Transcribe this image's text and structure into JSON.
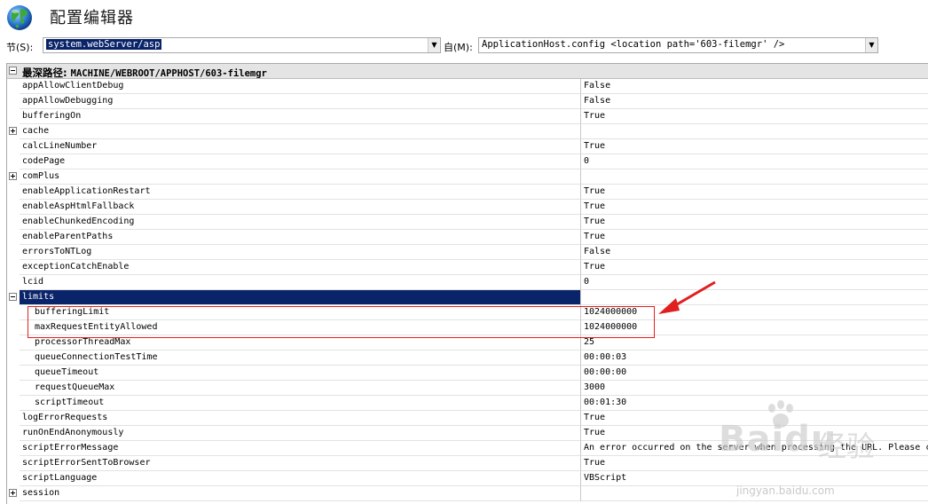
{
  "window": {
    "title": "配置编辑器"
  },
  "toolbar": {
    "section_label": "节(S):",
    "section_value": "system.webServer/asp",
    "from_label": "自(M):",
    "from_value": "ApplicationHost.config <location path='603-filemgr' />"
  },
  "grid": {
    "header_label": "最深路径:",
    "header_path": "MACHINE/WEBROOT/APPHOST/603-filemgr",
    "rows": [
      {
        "name": "appAllowClientDebug",
        "value": "False",
        "expander": "",
        "indent": 0
      },
      {
        "name": "appAllowDebugging",
        "value": "False",
        "expander": "",
        "indent": 0
      },
      {
        "name": "bufferingOn",
        "value": "True",
        "expander": "",
        "indent": 0
      },
      {
        "name": "cache",
        "value": "",
        "expander": "plus",
        "indent": 0
      },
      {
        "name": "calcLineNumber",
        "value": "True",
        "expander": "",
        "indent": 0
      },
      {
        "name": "codePage",
        "value": "0",
        "expander": "",
        "indent": 0
      },
      {
        "name": "comPlus",
        "value": "",
        "expander": "plus",
        "indent": 0
      },
      {
        "name": "enableApplicationRestart",
        "value": "True",
        "expander": "",
        "indent": 0
      },
      {
        "name": "enableAspHtmlFallback",
        "value": "True",
        "expander": "",
        "indent": 0
      },
      {
        "name": "enableChunkedEncoding",
        "value": "True",
        "expander": "",
        "indent": 0
      },
      {
        "name": "enableParentPaths",
        "value": "True",
        "expander": "",
        "indent": 0
      },
      {
        "name": "errorsToNTLog",
        "value": "False",
        "expander": "",
        "indent": 0
      },
      {
        "name": "exceptionCatchEnable",
        "value": "True",
        "expander": "",
        "indent": 0
      },
      {
        "name": "lcid",
        "value": "0",
        "expander": "",
        "indent": 0
      },
      {
        "name": "limits",
        "value": "",
        "expander": "minus",
        "indent": 0,
        "selected": true
      },
      {
        "name": "bufferingLimit",
        "value": "1024000000",
        "expander": "",
        "indent": 1
      },
      {
        "name": "maxRequestEntityAllowed",
        "value": "1024000000",
        "expander": "",
        "indent": 1
      },
      {
        "name": "processorThreadMax",
        "value": "25",
        "expander": "",
        "indent": 1
      },
      {
        "name": "queueConnectionTestTime",
        "value": "00:00:03",
        "expander": "",
        "indent": 1
      },
      {
        "name": "queueTimeout",
        "value": "00:00:00",
        "expander": "",
        "indent": 1
      },
      {
        "name": "requestQueueMax",
        "value": "3000",
        "expander": "",
        "indent": 1
      },
      {
        "name": "scriptTimeout",
        "value": "00:01:30",
        "expander": "",
        "indent": 1
      },
      {
        "name": "logErrorRequests",
        "value": "True",
        "expander": "",
        "indent": 0
      },
      {
        "name": "runOnEndAnonymously",
        "value": "True",
        "expander": "",
        "indent": 0
      },
      {
        "name": "scriptErrorMessage",
        "value": "An error occurred on the server when processing the URL. Please contact the system administrator.",
        "expander": "",
        "indent": 0
      },
      {
        "name": "scriptErrorSentToBrowser",
        "value": "True",
        "expander": "",
        "indent": 0
      },
      {
        "name": "scriptLanguage",
        "value": "VBScript",
        "expander": "",
        "indent": 0
      },
      {
        "name": "session",
        "value": "",
        "expander": "plus",
        "indent": 0
      }
    ]
  },
  "watermark": {
    "logo": "Baidu",
    "logo_cn": "经验",
    "url": "jingyan.baidu.com"
  },
  "colors": {
    "selection": "#0a246a",
    "annotation": "#e02020"
  },
  "icons": {
    "app": "globe-icon",
    "dropdown": "chevron-down-icon",
    "expand": "plus-box-icon",
    "collapse": "minus-box-icon",
    "annotation": "red-arrow-icon"
  }
}
